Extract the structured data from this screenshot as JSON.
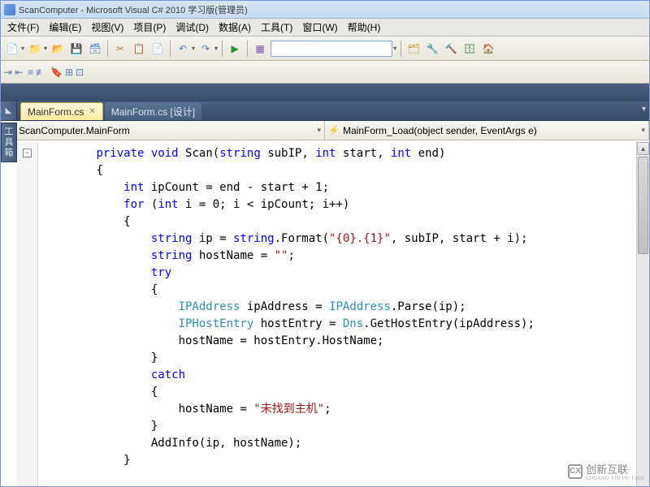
{
  "window": {
    "title": "ScanComputer - Microsoft Visual C# 2010 学习版(管理员)"
  },
  "menu": {
    "file": "文件(F)",
    "edit": "编辑(E)",
    "view": "视图(V)",
    "project": "项目(P)",
    "debug": "调试(D)",
    "data": "数据(A)",
    "tools": "工具(T)",
    "window": "窗口(W)",
    "help": "帮助(H)"
  },
  "tabs": {
    "active": "MainForm.cs",
    "inactive": "MainForm.cs [设计]"
  },
  "sidetool": "工具箱",
  "nav": {
    "left_icon": "🔧",
    "left": "ScanComputer.MainForm",
    "right_icon": "⚡",
    "right": "MainForm_Load(object sender, EventArgs e)"
  },
  "code": {
    "l1a": "private",
    "l1b": " ",
    "l1c": "void",
    "l1d": " Scan(",
    "l1e": "string",
    "l1f": " subIP, ",
    "l1g": "int",
    "l1h": " start, ",
    "l1i": "int",
    "l1j": " end)",
    "l2": "{",
    "l3a": "int",
    "l3b": " ipCount = end - start + 1;",
    "l4a": "for",
    "l4b": " (",
    "l4c": "int",
    "l4d": " i = 0; i < ipCount; i++)",
    "l5": "{",
    "l6a": "string",
    "l6b": " ip = ",
    "l6c": "string",
    "l6d": ".Format(",
    "l6e": "\"{0}.{1}\"",
    "l6f": ", subIP, start + i);",
    "l7a": "string",
    "l7b": " hostName = ",
    "l7c": "\"\"",
    "l7d": ";",
    "l8": "try",
    "l9": "{",
    "l10a": "IPAddress",
    "l10b": " ipAddress = ",
    "l10c": "IPAddress",
    "l10d": ".Parse(ip);",
    "l11a": "IPHostEntry",
    "l11b": " hostEntry = ",
    "l11c": "Dns",
    "l11d": ".GetHostEntry(ipAddress);",
    "l12": "hostName = hostEntry.HostName;",
    "l13": "}",
    "l14": "catch",
    "l15": "{",
    "l16a": "hostName = ",
    "l16b": "\"未找到主机\"",
    "l16c": ";",
    "l17": "}",
    "l18": "AddInfo(ip, hostName);",
    "l19": "}"
  },
  "watermark": {
    "logo": "CX",
    "text": "创新互联",
    "sub": "CHUANG XIN HU LIAN"
  }
}
